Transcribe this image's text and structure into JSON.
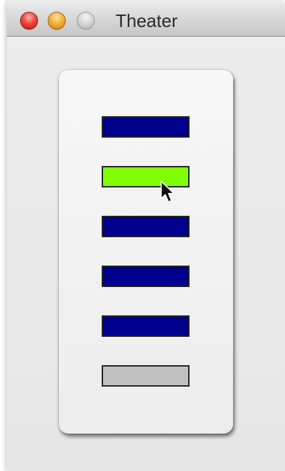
{
  "window": {
    "title": "Theater"
  },
  "panel": {
    "buttons": [
      {
        "name": "bar-button-1",
        "color": "#00008f",
        "state": "off"
      },
      {
        "name": "bar-button-2",
        "color": "#80ff00",
        "state": "active"
      },
      {
        "name": "bar-button-3",
        "color": "#00008f",
        "state": "off"
      },
      {
        "name": "bar-button-4",
        "color": "#00008f",
        "state": "off"
      },
      {
        "name": "bar-button-5",
        "color": "#00008f",
        "state": "off"
      },
      {
        "name": "bar-button-6",
        "color": "#c0c0c0",
        "state": "disabled"
      }
    ]
  },
  "icons": {
    "close": "close-traffic-light-icon",
    "minimize": "minimize-traffic-light-icon",
    "zoom": "zoom-traffic-light-icon",
    "cursor": "mouse-pointer-icon"
  }
}
